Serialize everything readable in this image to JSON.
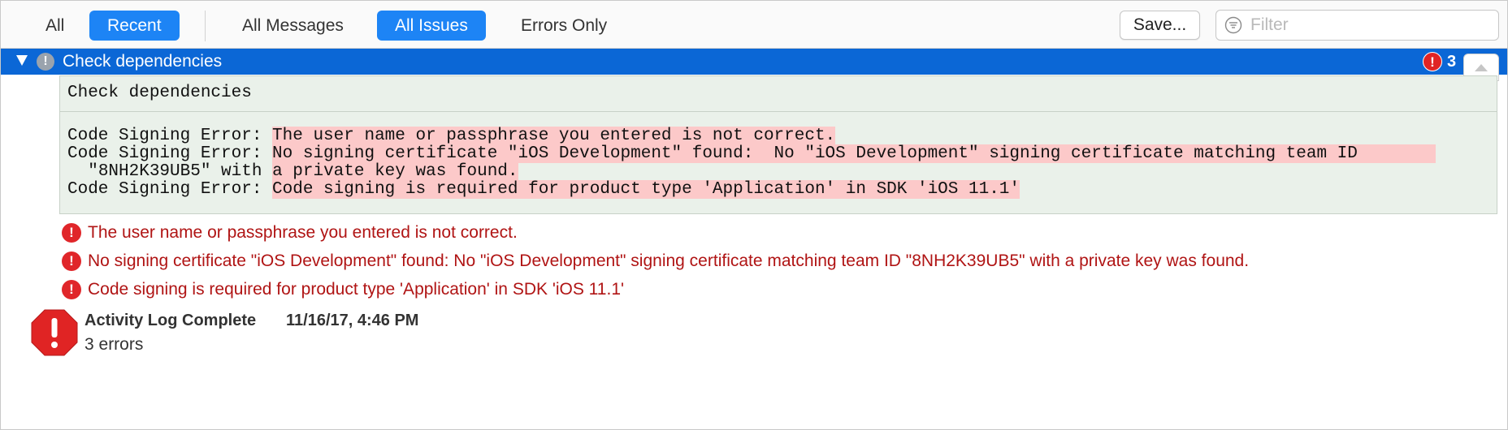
{
  "toolbar": {
    "scope_all": "All",
    "scope_recent": "Recent",
    "filter_all_messages": "All Messages",
    "filter_all_issues": "All Issues",
    "filter_errors_only": "Errors Only",
    "save_label": "Save...",
    "filter_placeholder": "Filter"
  },
  "group": {
    "title": "Check dependencies",
    "error_badge": "!",
    "error_count": "3"
  },
  "log": {
    "heading": "Check dependencies",
    "lines": [
      {
        "prefix": "Code Signing Error: ",
        "text": "The user name or passphrase you entered is not correct."
      },
      {
        "prefix": "Code Signing Error: ",
        "text": "No signing certificate \"iOS Development\" found:  No \"iOS Development\" signing certificate matching team ID "
      },
      {
        "prefix": "  ",
        "text_a": "\"8NH2K39UB5\" with ",
        "text": "a private key was found."
      },
      {
        "prefix": "Code Signing Error: ",
        "text": "Code signing is required for product type 'Application' in SDK 'iOS 11.1'"
      }
    ]
  },
  "errors": [
    "The user name or passphrase you entered is not correct.",
    "No signing certificate \"iOS Development\" found:  No \"iOS Development\" signing certificate matching team ID \"8NH2K39UB5\" with a private key was found.",
    "Code signing is required for product type 'Application' in SDK 'iOS 11.1'"
  ],
  "activity": {
    "title": "Activity Log Complete",
    "timestamp": "11/16/17, 4:46 PM",
    "summary": "3 errors"
  },
  "colors": {
    "accent": "#1d84f5",
    "selection": "#0b67d6",
    "error": "#e0262a",
    "error_text": "#b01414",
    "log_bg": "#eaf1ea",
    "highlight": "#fcc9c9"
  }
}
